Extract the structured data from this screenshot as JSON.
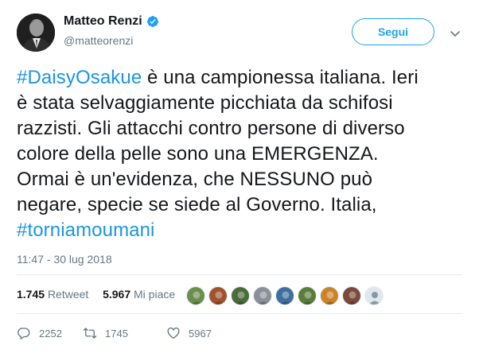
{
  "author": {
    "name": "Matteo Renzi",
    "handle": "@matteorenzi",
    "verified": true
  },
  "follow_button": {
    "label": "Segui"
  },
  "tweet": {
    "lines": [
      [
        {
          "text": "#DaisyOsakue",
          "hashtag": true
        },
        {
          "text": " è una campionessa italiana. Ieri"
        }
      ],
      [
        {
          "text": "è stata selvaggiamente picchiata da schifosi"
        }
      ],
      [
        {
          "text": "razzisti. Gli attacchi contro persone di diverso"
        }
      ],
      [
        {
          "text": "colore della pelle sono una EMERGENZA."
        }
      ],
      [
        {
          "text": "Ormai è un'evidenza, che NESSUNO può"
        }
      ],
      [
        {
          "text": "negare, specie se siede al Governo. Italia,"
        }
      ],
      [
        {
          "text": "#torniamoumani",
          "hashtag": true
        }
      ]
    ],
    "timestamp": "11:47 - 30 lug 2018"
  },
  "stats": {
    "retweets_count": "1.745",
    "retweets_label": "Retweet",
    "likes_count": "5.967",
    "likes_label": "Mi piace",
    "liker_avatar_colors": [
      "#6b8e4e",
      "#a0522d",
      "#4a6b3a",
      "#8a8f99",
      "#3f6fa0",
      "#5b7d3c",
      "#c9842b",
      "#7b4a3a"
    ]
  },
  "actions": {
    "reply_count": "2252",
    "retweet_count": "1745",
    "like_count": "5967"
  },
  "colors": {
    "accent": "#1da1f2",
    "hashtag": "#1b95e0",
    "muted": "#657786",
    "text": "#14171a",
    "divider": "#e6ecf0"
  }
}
